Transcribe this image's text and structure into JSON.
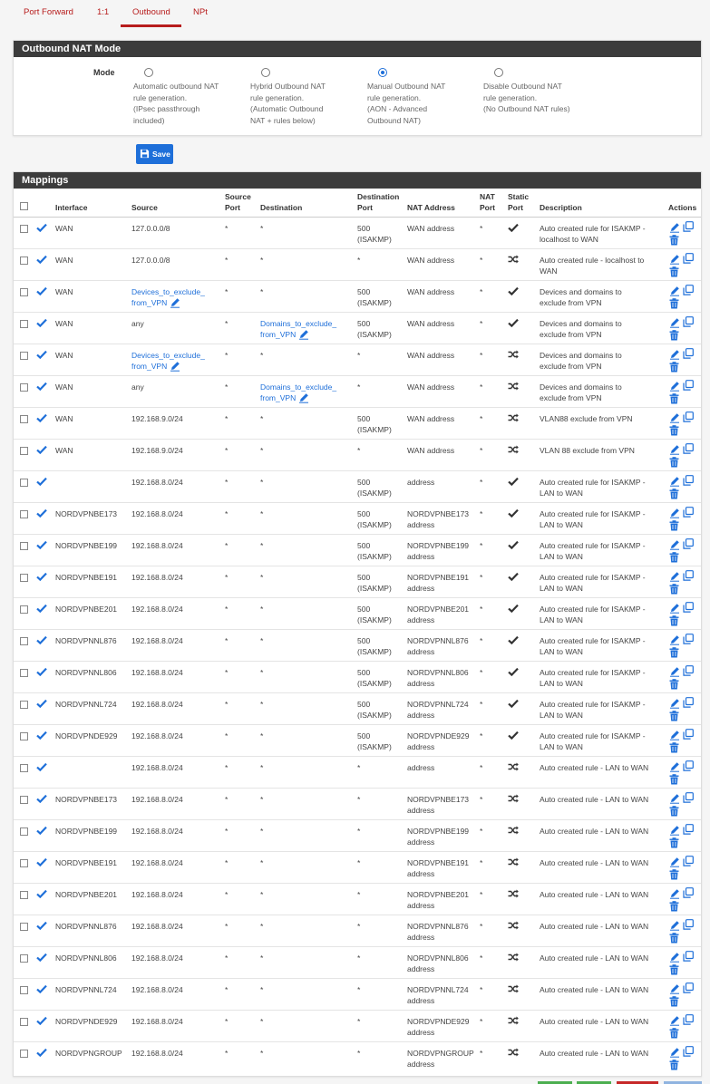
{
  "tabs": [
    {
      "label": "Port Forward",
      "active": false
    },
    {
      "label": "1:1",
      "active": false
    },
    {
      "label": "Outbound",
      "active": true
    },
    {
      "label": "NPt",
      "active": false
    }
  ],
  "mode_panel": {
    "title": "Outbound NAT Mode",
    "mode_label": "Mode",
    "options": [
      {
        "lines": [
          "Automatic outbound NAT",
          "rule generation.",
          "(IPsec passthrough",
          "included)"
        ],
        "checked": false
      },
      {
        "lines": [
          "Hybrid Outbound NAT",
          "rule generation.",
          "(Automatic Outbound",
          "NAT + rules below)"
        ],
        "checked": false
      },
      {
        "lines": [
          "Manual Outbound NAT",
          "rule generation.",
          "(AON - Advanced",
          "Outbound NAT)"
        ],
        "checked": true
      },
      {
        "lines": [
          "Disable Outbound NAT",
          "rule generation.",
          "(No Outbound NAT rules)"
        ],
        "checked": false
      }
    ]
  },
  "save_label": "Save",
  "mappings": {
    "title": "Mappings",
    "headers": {
      "interface": "Interface",
      "source": "Source",
      "source_port": [
        "Source",
        "Port"
      ],
      "destination": "Destination",
      "destination_port": [
        "Destination",
        "Port"
      ],
      "nat_address": "NAT Address",
      "nat_port": [
        "NAT",
        "Port"
      ],
      "static_port": [
        "Static",
        "Port"
      ],
      "description": "Description",
      "actions": "Actions"
    },
    "rows": [
      {
        "interface": "WAN",
        "source": [
          "127.0.0.0/8"
        ],
        "source_link": false,
        "source_port": "*",
        "destination": [
          "*"
        ],
        "destination_link": false,
        "destination_port": [
          "500",
          "(ISAKMP)"
        ],
        "nat_address": [
          "WAN address"
        ],
        "nat_port": "*",
        "static": "check",
        "description": [
          "Auto created rule for ISAKMP -",
          "localhost to WAN"
        ]
      },
      {
        "interface": "WAN",
        "source": [
          "127.0.0.0/8"
        ],
        "source_link": false,
        "source_port": "*",
        "destination": [
          "*"
        ],
        "destination_link": false,
        "destination_port": [
          "*"
        ],
        "nat_address": [
          "WAN address"
        ],
        "nat_port": "*",
        "static": "shuffle",
        "description": [
          "Auto created rule - localhost to",
          "WAN"
        ]
      },
      {
        "interface": "WAN",
        "source": [
          "Devices_to_exclude_",
          "from_VPN"
        ],
        "source_link": true,
        "source_port": "*",
        "destination": [
          "*"
        ],
        "destination_link": false,
        "destination_port": [
          "500",
          "(ISAKMP)"
        ],
        "nat_address": [
          "WAN address"
        ],
        "nat_port": "*",
        "static": "check",
        "description": [
          "Devices and domains to",
          "exclude from VPN"
        ]
      },
      {
        "interface": "WAN",
        "source": [
          "any"
        ],
        "source_link": false,
        "source_port": "*",
        "destination": [
          "Domains_to_exclude_",
          "from_VPN"
        ],
        "destination_link": true,
        "destination_port": [
          "500",
          "(ISAKMP)"
        ],
        "nat_address": [
          "WAN address"
        ],
        "nat_port": "*",
        "static": "check",
        "description": [
          "Devices and domains to",
          "exclude from VPN"
        ]
      },
      {
        "interface": "WAN",
        "source": [
          "Devices_to_exclude_",
          "from_VPN"
        ],
        "source_link": true,
        "source_port": "*",
        "destination": [
          "*"
        ],
        "destination_link": false,
        "destination_port": [
          "*"
        ],
        "nat_address": [
          "WAN address"
        ],
        "nat_port": "*",
        "static": "shuffle",
        "description": [
          "Devices and domains to",
          "exclude from VPN"
        ]
      },
      {
        "interface": "WAN",
        "source": [
          "any"
        ],
        "source_link": false,
        "source_port": "*",
        "destination": [
          "Domains_to_exclude_",
          "from_VPN"
        ],
        "destination_link": true,
        "destination_port": [
          "*"
        ],
        "nat_address": [
          "WAN address"
        ],
        "nat_port": "*",
        "static": "shuffle",
        "description": [
          "Devices and domains to",
          "exclude from VPN"
        ]
      },
      {
        "interface": "WAN",
        "source": [
          "192.168.9.0/24"
        ],
        "source_link": false,
        "source_port": "*",
        "destination": [
          "*"
        ],
        "destination_link": false,
        "destination_port": [
          "500",
          "(ISAKMP)"
        ],
        "nat_address": [
          "WAN address"
        ],
        "nat_port": "*",
        "static": "shuffle",
        "description": [
          "VLAN88 exclude from VPN"
        ]
      },
      {
        "interface": "WAN",
        "source": [
          "192.168.9.0/24"
        ],
        "source_link": false,
        "source_port": "*",
        "destination": [
          "*"
        ],
        "destination_link": false,
        "destination_port": [
          "*"
        ],
        "nat_address": [
          "WAN address"
        ],
        "nat_port": "*",
        "static": "shuffle",
        "description": [
          "VLAN 88 exclude from VPN"
        ]
      },
      {
        "interface": "",
        "source": [
          "192.168.8.0/24"
        ],
        "source_link": false,
        "source_port": "*",
        "destination": [
          "*"
        ],
        "destination_link": false,
        "destination_port": [
          "500",
          "(ISAKMP)"
        ],
        "nat_address": [
          "address"
        ],
        "nat_port": "*",
        "static": "check",
        "description": [
          "Auto created rule for ISAKMP -",
          "LAN to WAN"
        ]
      },
      {
        "interface": "NORDVPNBE173",
        "source": [
          "192.168.8.0/24"
        ],
        "source_link": false,
        "source_port": "*",
        "destination": [
          "*"
        ],
        "destination_link": false,
        "destination_port": [
          "500",
          "(ISAKMP)"
        ],
        "nat_address": [
          "NORDVPNBE173",
          "address"
        ],
        "nat_port": "*",
        "static": "check",
        "description": [
          "Auto created rule for ISAKMP -",
          "LAN to WAN"
        ]
      },
      {
        "interface": "NORDVPNBE199",
        "source": [
          "192.168.8.0/24"
        ],
        "source_link": false,
        "source_port": "*",
        "destination": [
          "*"
        ],
        "destination_link": false,
        "destination_port": [
          "500",
          "(ISAKMP)"
        ],
        "nat_address": [
          "NORDVPNBE199",
          "address"
        ],
        "nat_port": "*",
        "static": "check",
        "description": [
          "Auto created rule for ISAKMP -",
          "LAN to WAN"
        ]
      },
      {
        "interface": "NORDVPNBE191",
        "source": [
          "192.168.8.0/24"
        ],
        "source_link": false,
        "source_port": "*",
        "destination": [
          "*"
        ],
        "destination_link": false,
        "destination_port": [
          "500",
          "(ISAKMP)"
        ],
        "nat_address": [
          "NORDVPNBE191",
          "address"
        ],
        "nat_port": "*",
        "static": "check",
        "description": [
          "Auto created rule for ISAKMP -",
          "LAN to WAN"
        ]
      },
      {
        "interface": "NORDVPNBE201",
        "source": [
          "192.168.8.0/24"
        ],
        "source_link": false,
        "source_port": "*",
        "destination": [
          "*"
        ],
        "destination_link": false,
        "destination_port": [
          "500",
          "(ISAKMP)"
        ],
        "nat_address": [
          "NORDVPNBE201",
          "address"
        ],
        "nat_port": "*",
        "static": "check",
        "description": [
          "Auto created rule for ISAKMP -",
          "LAN to WAN"
        ]
      },
      {
        "interface": "NORDVPNNL876",
        "source": [
          "192.168.8.0/24"
        ],
        "source_link": false,
        "source_port": "*",
        "destination": [
          "*"
        ],
        "destination_link": false,
        "destination_port": [
          "500",
          "(ISAKMP)"
        ],
        "nat_address": [
          "NORDVPNNL876",
          "address"
        ],
        "nat_port": "*",
        "static": "check",
        "description": [
          "Auto created rule for ISAKMP -",
          "LAN to WAN"
        ]
      },
      {
        "interface": "NORDVPNNL806",
        "source": [
          "192.168.8.0/24"
        ],
        "source_link": false,
        "source_port": "*",
        "destination": [
          "*"
        ],
        "destination_link": false,
        "destination_port": [
          "500",
          "(ISAKMP)"
        ],
        "nat_address": [
          "NORDVPNNL806",
          "address"
        ],
        "nat_port": "*",
        "static": "check",
        "description": [
          "Auto created rule for ISAKMP -",
          "LAN to WAN"
        ]
      },
      {
        "interface": "NORDVPNNL724",
        "source": [
          "192.168.8.0/24"
        ],
        "source_link": false,
        "source_port": "*",
        "destination": [
          "*"
        ],
        "destination_link": false,
        "destination_port": [
          "500",
          "(ISAKMP)"
        ],
        "nat_address": [
          "NORDVPNNL724",
          "address"
        ],
        "nat_port": "*",
        "static": "check",
        "description": [
          "Auto created rule for ISAKMP -",
          "LAN to WAN"
        ]
      },
      {
        "interface": "NORDVPNDE929",
        "source": [
          "192.168.8.0/24"
        ],
        "source_link": false,
        "source_port": "*",
        "destination": [
          "*"
        ],
        "destination_link": false,
        "destination_port": [
          "500",
          "(ISAKMP)"
        ],
        "nat_address": [
          "NORDVPNDE929",
          "address"
        ],
        "nat_port": "*",
        "static": "check",
        "description": [
          "Auto created rule for ISAKMP -",
          "LAN to WAN"
        ]
      },
      {
        "interface": "",
        "source": [
          "192.168.8.0/24"
        ],
        "source_link": false,
        "source_port": "*",
        "destination": [
          "*"
        ],
        "destination_link": false,
        "destination_port": [
          "*"
        ],
        "nat_address": [
          "address"
        ],
        "nat_port": "*",
        "static": "shuffle",
        "description": [
          "Auto created rule - LAN to WAN"
        ]
      },
      {
        "interface": "NORDVPNBE173",
        "source": [
          "192.168.8.0/24"
        ],
        "source_link": false,
        "source_port": "*",
        "destination": [
          "*"
        ],
        "destination_link": false,
        "destination_port": [
          "*"
        ],
        "nat_address": [
          "NORDVPNBE173",
          "address"
        ],
        "nat_port": "*",
        "static": "shuffle",
        "description": [
          "Auto created rule - LAN to WAN"
        ]
      },
      {
        "interface": "NORDVPNBE199",
        "source": [
          "192.168.8.0/24"
        ],
        "source_link": false,
        "source_port": "*",
        "destination": [
          "*"
        ],
        "destination_link": false,
        "destination_port": [
          "*"
        ],
        "nat_address": [
          "NORDVPNBE199",
          "address"
        ],
        "nat_port": "*",
        "static": "shuffle",
        "description": [
          "Auto created rule - LAN to WAN"
        ]
      },
      {
        "interface": "NORDVPNBE191",
        "source": [
          "192.168.8.0/24"
        ],
        "source_link": false,
        "source_port": "*",
        "destination": [
          "*"
        ],
        "destination_link": false,
        "destination_port": [
          "*"
        ],
        "nat_address": [
          "NORDVPNBE191",
          "address"
        ],
        "nat_port": "*",
        "static": "shuffle",
        "description": [
          "Auto created rule - LAN to WAN"
        ]
      },
      {
        "interface": "NORDVPNBE201",
        "source": [
          "192.168.8.0/24"
        ],
        "source_link": false,
        "source_port": "*",
        "destination": [
          "*"
        ],
        "destination_link": false,
        "destination_port": [
          "*"
        ],
        "nat_address": [
          "NORDVPNBE201",
          "address"
        ],
        "nat_port": "*",
        "static": "shuffle",
        "description": [
          "Auto created rule - LAN to WAN"
        ]
      },
      {
        "interface": "NORDVPNNL876",
        "source": [
          "192.168.8.0/24"
        ],
        "source_link": false,
        "source_port": "*",
        "destination": [
          "*"
        ],
        "destination_link": false,
        "destination_port": [
          "*"
        ],
        "nat_address": [
          "NORDVPNNL876",
          "address"
        ],
        "nat_port": "*",
        "static": "shuffle",
        "description": [
          "Auto created rule - LAN to WAN"
        ]
      },
      {
        "interface": "NORDVPNNL806",
        "source": [
          "192.168.8.0/24"
        ],
        "source_link": false,
        "source_port": "*",
        "destination": [
          "*"
        ],
        "destination_link": false,
        "destination_port": [
          "*"
        ],
        "nat_address": [
          "NORDVPNNL806",
          "address"
        ],
        "nat_port": "*",
        "static": "shuffle",
        "description": [
          "Auto created rule - LAN to WAN"
        ]
      },
      {
        "interface": "NORDVPNNL724",
        "source": [
          "192.168.8.0/24"
        ],
        "source_link": false,
        "source_port": "*",
        "destination": [
          "*"
        ],
        "destination_link": false,
        "destination_port": [
          "*"
        ],
        "nat_address": [
          "NORDVPNNL724",
          "address"
        ],
        "nat_port": "*",
        "static": "shuffle",
        "description": [
          "Auto created rule - LAN to WAN"
        ]
      },
      {
        "interface": "NORDVPNDE929",
        "source": [
          "192.168.8.0/24"
        ],
        "source_link": false,
        "source_port": "*",
        "destination": [
          "*"
        ],
        "destination_link": false,
        "destination_port": [
          "*"
        ],
        "nat_address": [
          "NORDVPNDE929",
          "address"
        ],
        "nat_port": "*",
        "static": "shuffle",
        "description": [
          "Auto created rule - LAN to WAN"
        ]
      },
      {
        "interface": "NORDVPNGROUP",
        "source": [
          "192.168.8.0/24"
        ],
        "source_link": false,
        "source_port": "*",
        "destination": [
          "*"
        ],
        "destination_link": false,
        "destination_port": [
          "*"
        ],
        "nat_address": [
          "NORDVPNGROUP",
          "address"
        ],
        "nat_port": "*",
        "static": "shuffle",
        "description": [
          "Auto created rule - LAN to WAN"
        ]
      }
    ]
  },
  "icons": {
    "enabled": "check-icon",
    "static_check": "check-icon",
    "static_shuffle": "shuffle-icon",
    "edit": "pencil-icon",
    "copy": "copy-icon",
    "delete": "trash-icon",
    "save": "floppy-disk-icon"
  },
  "colors": {
    "accent": "#b71c1c",
    "link": "#1e6fd9",
    "panel_header": "#3c3c3c",
    "button_primary": "#1e6fd9",
    "button_success": "#4caf50",
    "button_danger": "#c62828",
    "button_info": "#90b4e0"
  }
}
